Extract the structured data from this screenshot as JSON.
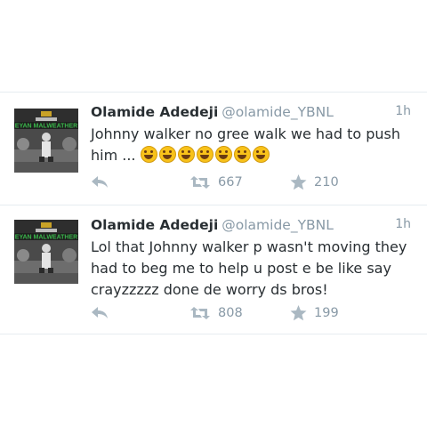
{
  "colors": {
    "name": "#292f33",
    "meta": "#8899a6",
    "icon": "#aab8c2",
    "emoji": "#f8c21a",
    "avatar_title": "#39b54a"
  },
  "tweets": [
    {
      "author_name": "Olamide Adedeji",
      "author_handle": "@olamide_YBNL",
      "time": "1h",
      "text": "Johnny walker no gree walk we had to push him ...",
      "emoji_count": 7,
      "emoji_name": "laughing-face-icon",
      "avatar_title": "EYAN MALWEATHER",
      "retweets": "667",
      "favorites": "210"
    },
    {
      "author_name": "Olamide Adedeji",
      "author_handle": "@olamide_YBNL",
      "time": "1h",
      "text": "Lol that Johnny walker p wasn't moving they had to beg me to help u post e be like say crayzzzzz done de worry ds bros!",
      "emoji_count": 0,
      "avatar_title": "EYAN MALWEATHER",
      "retweets": "808",
      "favorites": "199"
    }
  ]
}
